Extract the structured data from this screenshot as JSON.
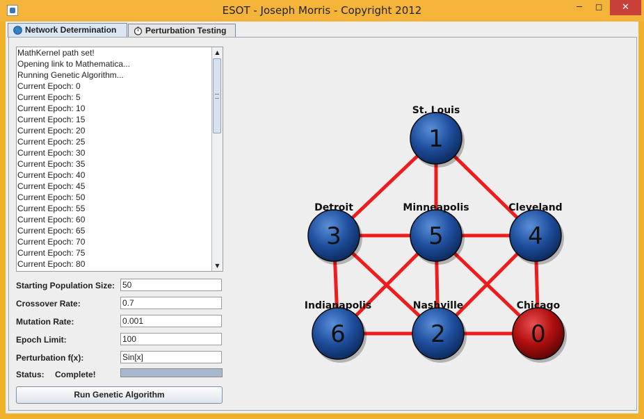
{
  "window": {
    "title": "ESOT - Joseph Morris - Copyright 2012"
  },
  "tabs": [
    {
      "label": "Network Determination",
      "active": true
    },
    {
      "label": "Perturbation Testing",
      "active": false
    }
  ],
  "log": {
    "lines": [
      "MathKernel path set!",
      "Opening link to Mathematica...",
      "Running Genetic Algorithm...",
      "Current Epoch: 0",
      "Current Epoch: 5",
      "Current Epoch: 10",
      "Current Epoch: 15",
      "Current Epoch: 20",
      "Current Epoch: 25",
      "Current Epoch: 30",
      "Current Epoch: 35",
      "Current Epoch: 40",
      "Current Epoch: 45",
      "Current Epoch: 50",
      "Current Epoch: 55",
      "Current Epoch: 60",
      "Current Epoch: 65",
      "Current Epoch: 70",
      "Current Epoch: 75",
      "Current Epoch: 80"
    ]
  },
  "form": {
    "population": {
      "label": "Starting Population Size:",
      "value": "50"
    },
    "crossover": {
      "label": "Crossover Rate:",
      "value": "0.7"
    },
    "mutation": {
      "label": "Mutation Rate:",
      "value": "0.001"
    },
    "epoch_limit": {
      "label": "Epoch Limit:",
      "value": "100"
    },
    "perturbation": {
      "label": "Perturbation f(x):",
      "value": "Sin[x]"
    },
    "status": {
      "label": "Status:",
      "value": "Complete!",
      "progress": 1.0
    },
    "run_button": "Run Genetic Algorithm"
  },
  "network": {
    "nodes": [
      {
        "id": "1",
        "label": "St. Louis",
        "color": "blue"
      },
      {
        "id": "3",
        "label": "Detroit",
        "color": "blue"
      },
      {
        "id": "5",
        "label": "Minneapolis",
        "color": "blue"
      },
      {
        "id": "4",
        "label": "Cleveland",
        "color": "blue"
      },
      {
        "id": "6",
        "label": "Indianapolis",
        "color": "blue"
      },
      {
        "id": "2",
        "label": "Nashville",
        "color": "blue"
      },
      {
        "id": "0",
        "label": "Chicago",
        "color": "red"
      }
    ],
    "edges": [
      [
        "1",
        "3"
      ],
      [
        "1",
        "5"
      ],
      [
        "1",
        "4"
      ],
      [
        "3",
        "5"
      ],
      [
        "5",
        "4"
      ],
      [
        "3",
        "6"
      ],
      [
        "3",
        "2"
      ],
      [
        "5",
        "6"
      ],
      [
        "5",
        "2"
      ],
      [
        "5",
        "0"
      ],
      [
        "4",
        "2"
      ],
      [
        "4",
        "0"
      ],
      [
        "6",
        "2"
      ],
      [
        "2",
        "0"
      ]
    ],
    "edge_color": "#ee1c1c",
    "node_colors": {
      "blue": "#1f4f9e",
      "red": "#b00f0f"
    }
  }
}
